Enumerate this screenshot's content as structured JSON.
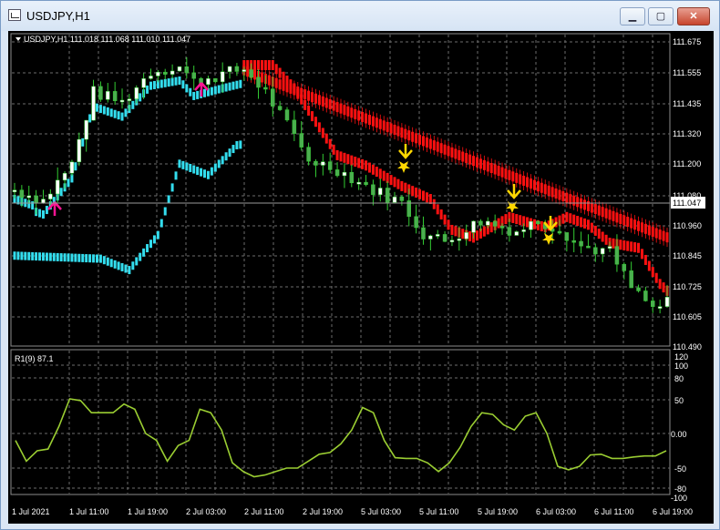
{
  "window": {
    "title": "USDJPY,H1",
    "buttons": {
      "minimize": "▁",
      "maximize": "▢",
      "close": "✕"
    }
  },
  "main_chart": {
    "header": "USDJPY,H1  111.018 111.068 111.010 111.047",
    "price_axis": [
      "111.675",
      "111.555",
      "111.435",
      "111.320",
      "111.200",
      "111.080",
      "110.960",
      "110.845",
      "110.725",
      "110.605",
      "110.490"
    ],
    "current_price": "111.047",
    "colors": {
      "background": "#000000",
      "grid": "#6c6c6c",
      "bull_candle": "#ffffff",
      "bear_candle": "#4caf50",
      "candle_wick": "#33cc33",
      "up_trend": "#33ddee",
      "down_trend": "#ff1111",
      "buy_arrow": "#ff1493",
      "sell_arrow": "#ffd700"
    }
  },
  "indicator": {
    "header": "R1(9) 87.1",
    "axis": [
      "120",
      "100",
      "80",
      "50",
      "0.00",
      "-50",
      "-80",
      "-100"
    ],
    "color": "#9acd32"
  },
  "time_axis": [
    "1 Jul 2021",
    "1 Jul 11:00",
    "1 Jul 19:00",
    "2 Jul 03:00",
    "2 Jul 11:00",
    "2 Jul 19:00",
    "5 Jul 03:00",
    "5 Jul 11:00",
    "5 Jul 19:00",
    "6 Jul 03:00",
    "6 Jul 11:00",
    "6 Jul 19:00"
  ]
}
